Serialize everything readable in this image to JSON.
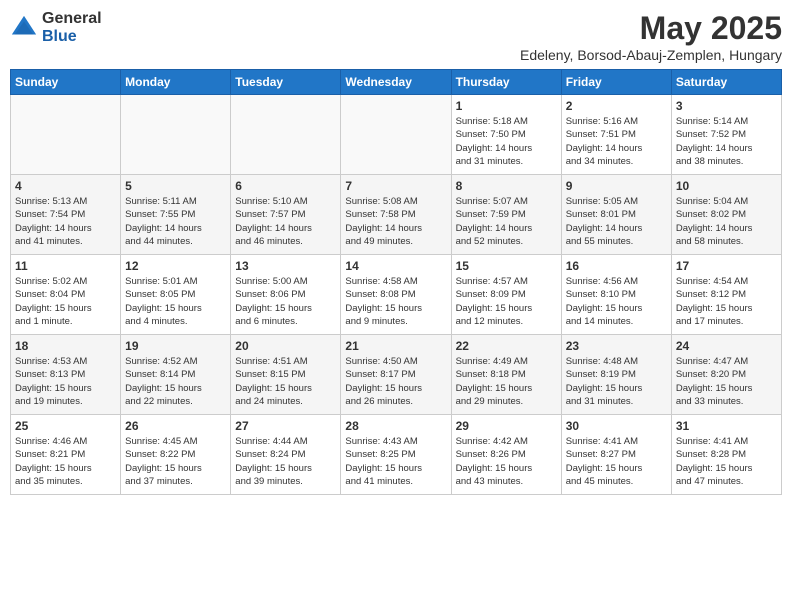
{
  "header": {
    "logo_general": "General",
    "logo_blue": "Blue",
    "month_title": "May 2025",
    "subtitle": "Edeleny, Borsod-Abauj-Zemplen, Hungary"
  },
  "days_of_week": [
    "Sunday",
    "Monday",
    "Tuesday",
    "Wednesday",
    "Thursday",
    "Friday",
    "Saturday"
  ],
  "weeks": [
    [
      {
        "day": "",
        "content": ""
      },
      {
        "day": "",
        "content": ""
      },
      {
        "day": "",
        "content": ""
      },
      {
        "day": "",
        "content": ""
      },
      {
        "day": "1",
        "content": "Sunrise: 5:18 AM\nSunset: 7:50 PM\nDaylight: 14 hours\nand 31 minutes."
      },
      {
        "day": "2",
        "content": "Sunrise: 5:16 AM\nSunset: 7:51 PM\nDaylight: 14 hours\nand 34 minutes."
      },
      {
        "day": "3",
        "content": "Sunrise: 5:14 AM\nSunset: 7:52 PM\nDaylight: 14 hours\nand 38 minutes."
      }
    ],
    [
      {
        "day": "4",
        "content": "Sunrise: 5:13 AM\nSunset: 7:54 PM\nDaylight: 14 hours\nand 41 minutes."
      },
      {
        "day": "5",
        "content": "Sunrise: 5:11 AM\nSunset: 7:55 PM\nDaylight: 14 hours\nand 44 minutes."
      },
      {
        "day": "6",
        "content": "Sunrise: 5:10 AM\nSunset: 7:57 PM\nDaylight: 14 hours\nand 46 minutes."
      },
      {
        "day": "7",
        "content": "Sunrise: 5:08 AM\nSunset: 7:58 PM\nDaylight: 14 hours\nand 49 minutes."
      },
      {
        "day": "8",
        "content": "Sunrise: 5:07 AM\nSunset: 7:59 PM\nDaylight: 14 hours\nand 52 minutes."
      },
      {
        "day": "9",
        "content": "Sunrise: 5:05 AM\nSunset: 8:01 PM\nDaylight: 14 hours\nand 55 minutes."
      },
      {
        "day": "10",
        "content": "Sunrise: 5:04 AM\nSunset: 8:02 PM\nDaylight: 14 hours\nand 58 minutes."
      }
    ],
    [
      {
        "day": "11",
        "content": "Sunrise: 5:02 AM\nSunset: 8:04 PM\nDaylight: 15 hours\nand 1 minute."
      },
      {
        "day": "12",
        "content": "Sunrise: 5:01 AM\nSunset: 8:05 PM\nDaylight: 15 hours\nand 4 minutes."
      },
      {
        "day": "13",
        "content": "Sunrise: 5:00 AM\nSunset: 8:06 PM\nDaylight: 15 hours\nand 6 minutes."
      },
      {
        "day": "14",
        "content": "Sunrise: 4:58 AM\nSunset: 8:08 PM\nDaylight: 15 hours\nand 9 minutes."
      },
      {
        "day": "15",
        "content": "Sunrise: 4:57 AM\nSunset: 8:09 PM\nDaylight: 15 hours\nand 12 minutes."
      },
      {
        "day": "16",
        "content": "Sunrise: 4:56 AM\nSunset: 8:10 PM\nDaylight: 15 hours\nand 14 minutes."
      },
      {
        "day": "17",
        "content": "Sunrise: 4:54 AM\nSunset: 8:12 PM\nDaylight: 15 hours\nand 17 minutes."
      }
    ],
    [
      {
        "day": "18",
        "content": "Sunrise: 4:53 AM\nSunset: 8:13 PM\nDaylight: 15 hours\nand 19 minutes."
      },
      {
        "day": "19",
        "content": "Sunrise: 4:52 AM\nSunset: 8:14 PM\nDaylight: 15 hours\nand 22 minutes."
      },
      {
        "day": "20",
        "content": "Sunrise: 4:51 AM\nSunset: 8:15 PM\nDaylight: 15 hours\nand 24 minutes."
      },
      {
        "day": "21",
        "content": "Sunrise: 4:50 AM\nSunset: 8:17 PM\nDaylight: 15 hours\nand 26 minutes."
      },
      {
        "day": "22",
        "content": "Sunrise: 4:49 AM\nSunset: 8:18 PM\nDaylight: 15 hours\nand 29 minutes."
      },
      {
        "day": "23",
        "content": "Sunrise: 4:48 AM\nSunset: 8:19 PM\nDaylight: 15 hours\nand 31 minutes."
      },
      {
        "day": "24",
        "content": "Sunrise: 4:47 AM\nSunset: 8:20 PM\nDaylight: 15 hours\nand 33 minutes."
      }
    ],
    [
      {
        "day": "25",
        "content": "Sunrise: 4:46 AM\nSunset: 8:21 PM\nDaylight: 15 hours\nand 35 minutes."
      },
      {
        "day": "26",
        "content": "Sunrise: 4:45 AM\nSunset: 8:22 PM\nDaylight: 15 hours\nand 37 minutes."
      },
      {
        "day": "27",
        "content": "Sunrise: 4:44 AM\nSunset: 8:24 PM\nDaylight: 15 hours\nand 39 minutes."
      },
      {
        "day": "28",
        "content": "Sunrise: 4:43 AM\nSunset: 8:25 PM\nDaylight: 15 hours\nand 41 minutes."
      },
      {
        "day": "29",
        "content": "Sunrise: 4:42 AM\nSunset: 8:26 PM\nDaylight: 15 hours\nand 43 minutes."
      },
      {
        "day": "30",
        "content": "Sunrise: 4:41 AM\nSunset: 8:27 PM\nDaylight: 15 hours\nand 45 minutes."
      },
      {
        "day": "31",
        "content": "Sunrise: 4:41 AM\nSunset: 8:28 PM\nDaylight: 15 hours\nand 47 minutes."
      }
    ]
  ]
}
